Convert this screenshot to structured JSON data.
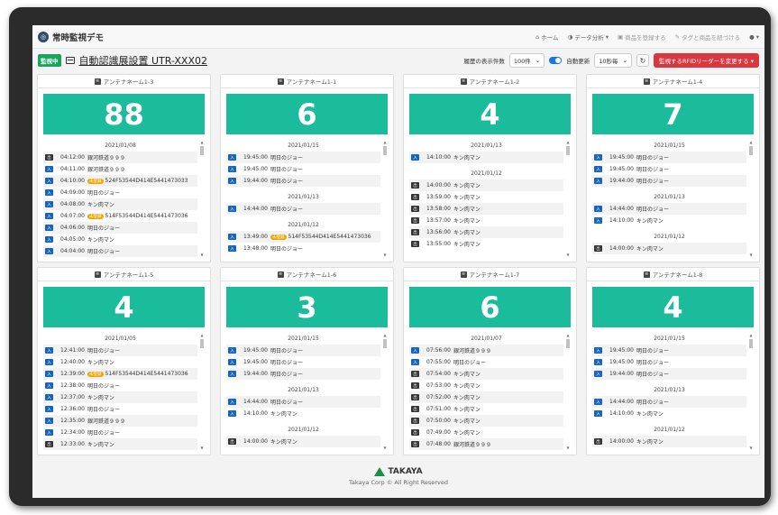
{
  "navbar": {
    "brand": "常時監視デモ",
    "home": "ホーム",
    "analysis": "データ分析",
    "register": "商品を登録する",
    "tag_link": "タグと商品を紐づける"
  },
  "subheader": {
    "status_badge": "監視中",
    "device_title": "自動認識展設置 UTR-XXX02",
    "history_label": "履歴の表示件数",
    "history_value": "100件",
    "auto_update_label": "自動更新",
    "interval_value": "10秒毎",
    "change_button": "監視するRFIDリーダーを変更する"
  },
  "icons": {
    "in_label": "入",
    "out_label": "出",
    "unregistered_label": "未登録"
  },
  "cards": [
    {
      "name": "アンテナネーム1-3",
      "count": "88",
      "groups": [
        {
          "date": "2021/01/08",
          "rows": [
            {
              "type": "出",
              "time": "04:12:00",
              "text": "銀河鉄道９９９",
              "unreg": false
            },
            {
              "type": "入",
              "time": "04:11:00",
              "text": "銀河鉄道９９９",
              "unreg": false
            },
            {
              "type": "入",
              "time": "04:10:00",
              "text": "524F53544D414E5441473033",
              "unreg": true
            },
            {
              "type": "入",
              "time": "04:09:00",
              "text": "明日のジョー",
              "unreg": false
            },
            {
              "type": "入",
              "time": "04:08:00",
              "text": "キン肉マン",
              "unreg": false
            },
            {
              "type": "入",
              "time": "04:07:00",
              "text": "514F53544D414E5441473036",
              "unreg": true
            },
            {
              "type": "入",
              "time": "04:06:00",
              "text": "明日のジョー",
              "unreg": false
            },
            {
              "type": "入",
              "time": "04:05:00",
              "text": "キン肉マン",
              "unreg": false
            },
            {
              "type": "入",
              "time": "04:04:00",
              "text": "明日のジョー",
              "unreg": false
            }
          ]
        }
      ]
    },
    {
      "name": "アンテナネーム1-1",
      "count": "6",
      "groups": [
        {
          "date": "2021/01/15",
          "rows": [
            {
              "type": "入",
              "time": "19:45:00",
              "text": "明日のジョー",
              "unreg": false
            },
            {
              "type": "入",
              "time": "19:45:00",
              "text": "明日のジョー",
              "unreg": false
            },
            {
              "type": "入",
              "time": "19:44:00",
              "text": "明日のジョー",
              "unreg": false
            }
          ]
        },
        {
          "date": "2021/01/13",
          "rows": [
            {
              "type": "入",
              "time": "14:44:00",
              "text": "明日のジョー",
              "unreg": false
            }
          ]
        },
        {
          "date": "2021/01/12",
          "rows": [
            {
              "type": "入",
              "time": "13:49:00",
              "text": "514F53544D414E5441473036",
              "unreg": true
            },
            {
              "type": "入",
              "time": "13:48:00",
              "text": "明日のジョー",
              "unreg": false
            }
          ]
        }
      ]
    },
    {
      "name": "アンテナネーム1-2",
      "count": "4",
      "groups": [
        {
          "date": "2021/01/13",
          "rows": [
            {
              "type": "入",
              "time": "14:10:00",
              "text": "キン肉マン",
              "unreg": false
            }
          ]
        },
        {
          "date": "2021/01/12",
          "rows": [
            {
              "type": "出",
              "time": "14:00:00",
              "text": "キン肉マン",
              "unreg": false
            },
            {
              "type": "出",
              "time": "13:59:00",
              "text": "キン肉マン",
              "unreg": false
            },
            {
              "type": "出",
              "time": "13:58:00",
              "text": "キン肉マン",
              "unreg": false
            },
            {
              "type": "出",
              "time": "13:57:00",
              "text": "キン肉マン",
              "unreg": false
            },
            {
              "type": "出",
              "time": "13:56:00",
              "text": "キン肉マン",
              "unreg": false
            },
            {
              "type": "出",
              "time": "13:55:00",
              "text": "キン肉マン",
              "unreg": false
            }
          ]
        }
      ]
    },
    {
      "name": "アンテナネーム1-4",
      "count": "7",
      "groups": [
        {
          "date": "2021/01/15",
          "rows": [
            {
              "type": "入",
              "time": "19:45:00",
              "text": "明日のジョー",
              "unreg": false
            },
            {
              "type": "入",
              "time": "19:45:00",
              "text": "明日のジョー",
              "unreg": false
            },
            {
              "type": "入",
              "time": "19:44:00",
              "text": "明日のジョー",
              "unreg": false
            }
          ]
        },
        {
          "date": "2021/01/13",
          "rows": [
            {
              "type": "入",
              "time": "14:44:00",
              "text": "明日のジョー",
              "unreg": false
            },
            {
              "type": "入",
              "time": "14:10:00",
              "text": "キン肉マン",
              "unreg": false
            }
          ]
        },
        {
          "date": "2021/01/12",
          "rows": [
            {
              "type": "出",
              "time": "14:00:00",
              "text": "キン肉マン",
              "unreg": false
            }
          ]
        }
      ]
    },
    {
      "name": "アンテナネーム1-5",
      "count": "4",
      "groups": [
        {
          "date": "2021/01/05",
          "rows": [
            {
              "type": "入",
              "time": "12:41:00",
              "text": "明日のジョー",
              "unreg": false
            },
            {
              "type": "入",
              "time": "12:40:00",
              "text": "キン肉マン",
              "unreg": false
            },
            {
              "type": "入",
              "time": "12:39:00",
              "text": "514F53544D414E5441473036",
              "unreg": true
            },
            {
              "type": "入",
              "time": "12:38:00",
              "text": "明日のジョー",
              "unreg": false
            },
            {
              "type": "入",
              "time": "12:37:00",
              "text": "キン肉マン",
              "unreg": false
            },
            {
              "type": "入",
              "time": "12:36:00",
              "text": "明日のジョー",
              "unreg": false
            },
            {
              "type": "入",
              "time": "12:35:00",
              "text": "銀河鉄道９９９",
              "unreg": false
            },
            {
              "type": "入",
              "time": "12:34:00",
              "text": "明日のジョー",
              "unreg": false
            },
            {
              "type": "出",
              "time": "12:33:00",
              "text": "キン肉マン",
              "unreg": false
            }
          ]
        }
      ]
    },
    {
      "name": "アンテナネーム1-6",
      "count": "3",
      "groups": [
        {
          "date": "2021/01/15",
          "rows": [
            {
              "type": "入",
              "time": "19:45:00",
              "text": "明日のジョー",
              "unreg": false
            },
            {
              "type": "入",
              "time": "19:45:00",
              "text": "明日のジョー",
              "unreg": false
            },
            {
              "type": "入",
              "time": "19:44:00",
              "text": "明日のジョー",
              "unreg": false
            }
          ]
        },
        {
          "date": "2021/01/13",
          "rows": [
            {
              "type": "入",
              "time": "14:44:00",
              "text": "明日のジョー",
              "unreg": false
            },
            {
              "type": "入",
              "time": "14:10:00",
              "text": "キン肉マン",
              "unreg": false
            }
          ]
        },
        {
          "date": "2021/01/12",
          "rows": [
            {
              "type": "出",
              "time": "14:00:00",
              "text": "キン肉マン",
              "unreg": false
            }
          ]
        }
      ]
    },
    {
      "name": "アンテナネーム1-7",
      "count": "6",
      "groups": [
        {
          "date": "2021/01/07",
          "rows": [
            {
              "type": "入",
              "time": "07:56:00",
              "text": "銀河鉄道９９９",
              "unreg": false
            },
            {
              "type": "入",
              "time": "07:55:00",
              "text": "明日のジョー",
              "unreg": false
            },
            {
              "type": "出",
              "time": "07:54:00",
              "text": "キン肉マン",
              "unreg": false
            },
            {
              "type": "出",
              "time": "07:53:00",
              "text": "キン肉マン",
              "unreg": false
            },
            {
              "type": "出",
              "time": "07:52:00",
              "text": "キン肉マン",
              "unreg": false
            },
            {
              "type": "出",
              "time": "07:51:00",
              "text": "キン肉マン",
              "unreg": false
            },
            {
              "type": "出",
              "time": "07:50:00",
              "text": "キン肉マン",
              "unreg": false
            },
            {
              "type": "出",
              "time": "07:49:00",
              "text": "キン肉マン",
              "unreg": false
            },
            {
              "type": "出",
              "time": "07:48:00",
              "text": "銀河鉄道９９９",
              "unreg": false
            }
          ]
        }
      ]
    },
    {
      "name": "アンテナネーム1-8",
      "count": "4",
      "groups": [
        {
          "date": "2021/01/15",
          "rows": [
            {
              "type": "入",
              "time": "19:45:00",
              "text": "明日のジョー",
              "unreg": false
            },
            {
              "type": "入",
              "time": "19:45:00",
              "text": "明日のジョー",
              "unreg": false
            },
            {
              "type": "入",
              "time": "19:44:00",
              "text": "明日のジョー",
              "unreg": false
            }
          ]
        },
        {
          "date": "2021/01/13",
          "rows": [
            {
              "type": "入",
              "time": "14:44:00",
              "text": "明日のジョー",
              "unreg": false
            },
            {
              "type": "入",
              "time": "14:10:00",
              "text": "キン肉マン",
              "unreg": false
            }
          ]
        },
        {
          "date": "2021/01/12",
          "rows": [
            {
              "type": "出",
              "time": "14:00:00",
              "text": "キン肉マン",
              "unreg": false
            }
          ]
        }
      ]
    }
  ],
  "footer": {
    "logo_text": "TAKAYA",
    "copyright": "Takaya Corp © All Right Reserved"
  },
  "colors": {
    "count_box": "#1abc9c",
    "in_tag": "#1565c0",
    "out_tag": "#333333",
    "unregistered": "#f0a500",
    "change_button": "#d9363e",
    "live_badge": "#1aa35d"
  }
}
